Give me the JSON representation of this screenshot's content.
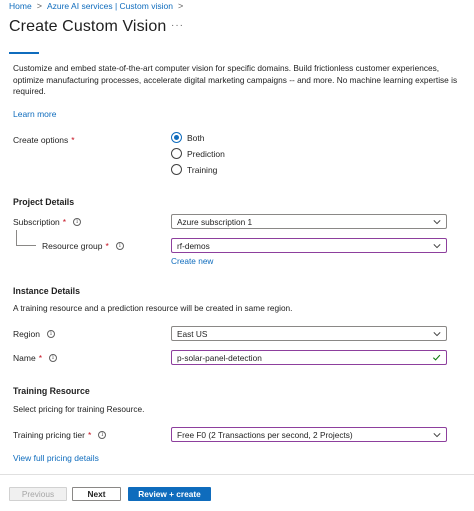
{
  "breadcrumb": {
    "home": "Home",
    "separator": ">",
    "services": "Azure AI services | Custom vision"
  },
  "page": {
    "title": "Create Custom Vision",
    "more": "···"
  },
  "description": "Customize and embed state-of-the-art computer vision for specific domains. Build frictionless customer experiences, optimize manufacturing processes, accelerate digital marketing campaigns -- and more. No machine learning expertise is required.",
  "learn_more": "Learn more",
  "create_options": {
    "label": "Create options",
    "required": "*",
    "options": [
      "Both",
      "Prediction",
      "Training"
    ],
    "selected": "Both"
  },
  "project_details": {
    "title": "Project Details",
    "subscription": {
      "label": "Subscription",
      "required": "*",
      "value": "Azure subscription 1"
    },
    "resource_group": {
      "label": "Resource group",
      "required": "*",
      "value": "rf-demos",
      "create_new": "Create new"
    }
  },
  "instance_details": {
    "title": "Instance Details",
    "note": "A training resource and a prediction resource will be created in same region.",
    "region": {
      "label": "Region",
      "value": "East US"
    },
    "name": {
      "label": "Name",
      "required": "*",
      "value": "p-solar-panel-detection"
    }
  },
  "training_resource": {
    "title": "Training Resource",
    "note": "Select pricing for training Resource.",
    "pricing_tier": {
      "label": "Training pricing tier",
      "required": "*",
      "value": "Free F0 (2 Transactions per second, 2 Projects)"
    },
    "view_pricing": "View full pricing details"
  },
  "footer": {
    "previous": "Previous",
    "next": "Next",
    "review": "Review + create"
  },
  "colors": {
    "accent": "#0f6cbd",
    "focus_border": "#8d3f9d",
    "required": "#c50f1f",
    "valid_check": "#107c10"
  },
  "icons": [
    "info-icon",
    "chevron-down-icon",
    "checkmark-icon",
    "more-icon"
  ]
}
